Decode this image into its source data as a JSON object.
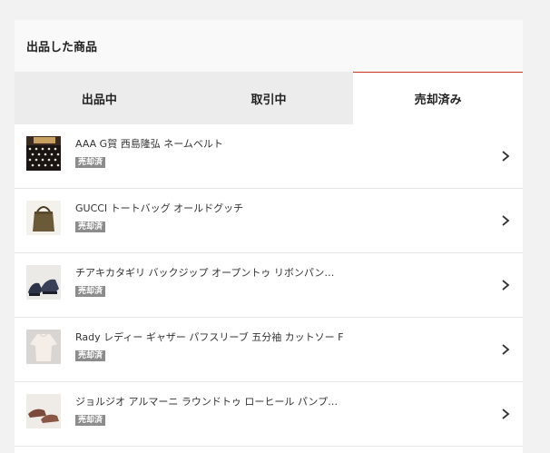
{
  "panel": {
    "title": "出品した商品"
  },
  "tabs": [
    {
      "label": "出品中",
      "active": false
    },
    {
      "label": "取引中",
      "active": false
    },
    {
      "label": "売却済み",
      "active": true
    }
  ],
  "items": [
    {
      "title": "AAA G賀 西島隆弘 ネームベルト",
      "badge": "売却済",
      "thumb_icon": "polka-dot-belt-photo"
    },
    {
      "title": "GUCCI トートバッグ オールドグッチ",
      "badge": "売却済",
      "thumb_icon": "tote-bag-photo"
    },
    {
      "title": "チアキカタギリ バックジップ オープントゥ リボンパン…",
      "badge": "売却済",
      "thumb_icon": "shoes-photo"
    },
    {
      "title": "Rady レディー ギャザー パフスリーブ 五分袖 カットソー F",
      "badge": "売却済",
      "thumb_icon": "blouse-photo"
    },
    {
      "title": "ジョルジオ アルマーニ ラウンドトゥ ローヒール パンプ…",
      "badge": "売却済",
      "thumb_icon": "pumps-photo"
    }
  ],
  "colors": {
    "accent": "#c8331f",
    "badge_bg": "#8c8c8c",
    "tab_inactive_bg": "#ececec"
  }
}
